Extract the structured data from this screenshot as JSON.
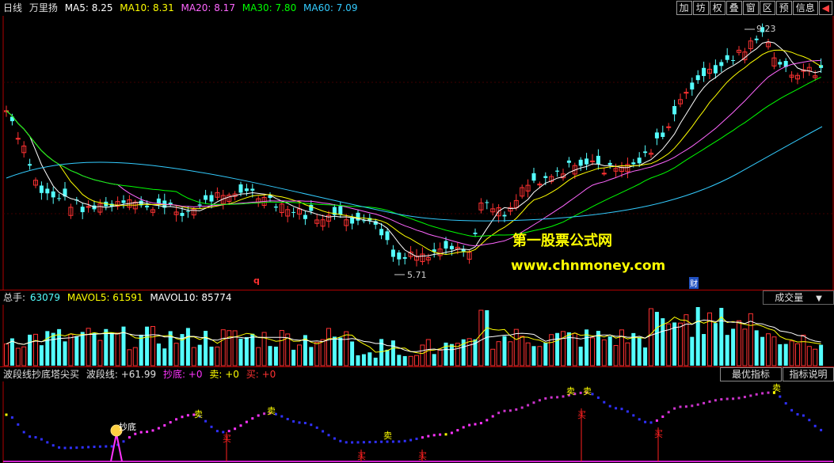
{
  "main": {
    "period": "日线",
    "stock": "万里扬",
    "ma": [
      {
        "label": "MA5: 8.25",
        "color": "#ffffff"
      },
      {
        "label": "MA10: 8.31",
        "color": "#ffff00"
      },
      {
        "label": "MA20: 8.17",
        "color": "#ff66ff"
      },
      {
        "label": "MA30: 7.80",
        "color": "#00ff00"
      },
      {
        "label": "MA60: 7.09",
        "color": "#33ccff"
      }
    ],
    "toolbar": [
      "加",
      "坊",
      "权",
      "叠",
      "窗",
      "区",
      "预",
      "信息",
      "◀"
    ],
    "high_label": "9.23",
    "low_label": "5.71",
    "marker_q": "q",
    "marker_cai": "财",
    "watermark_cn": "第一股票公式网",
    "watermark_url": "www.chnmoney.com"
  },
  "volume": {
    "title": "总手:",
    "value": "63079",
    "mavol5": "MAVOL5: 61591",
    "mavol10": "MAVOL10: 85774",
    "selector": "成交量",
    "selector_arrow": "▼"
  },
  "indicator": {
    "name": "波段线抄底塔尖买",
    "line_label": "波段线: +61.99",
    "chaodi": "抄底: +0",
    "mai_sell": "卖: +0",
    "mai_buy": "买: +0",
    "btn_best": "最优指标",
    "btn_help": "指标说明",
    "chaodi_mark": "抄底",
    "sell_mark": "卖",
    "buy_mark": "买"
  },
  "colors": {
    "up": "#ff3232",
    "down": "#54ffff",
    "ma5": "#ffffff",
    "ma10": "#ffff00",
    "ma20": "#ff66ff",
    "ma30": "#00ff00",
    "ma60": "#33ccff",
    "separator": "#b00000"
  }
}
